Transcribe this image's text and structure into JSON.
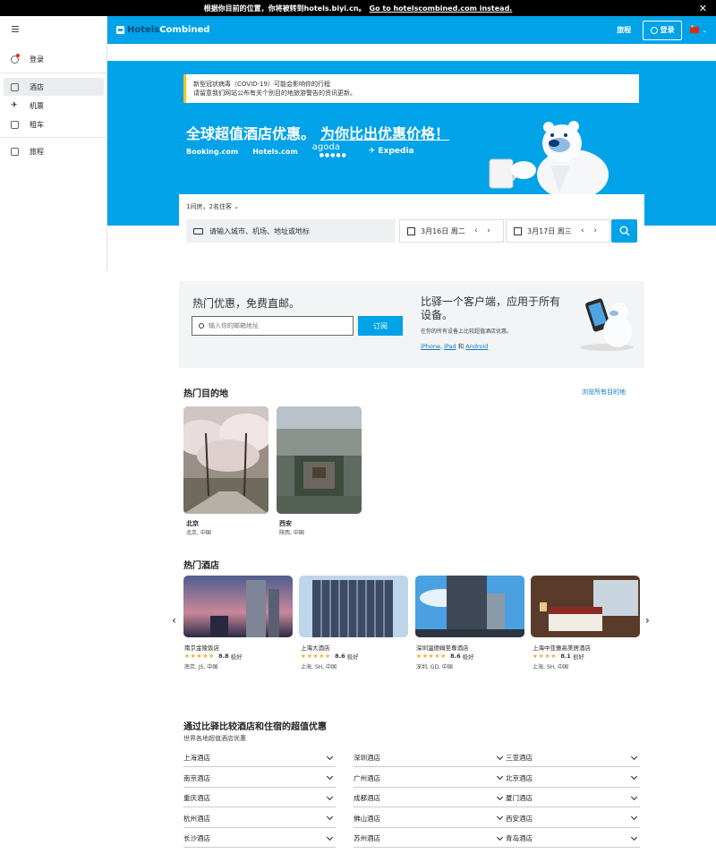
{
  "banner": {
    "text": "根据你目前的位置，你将被转到hotels.biyi.cn。",
    "link": "Go to hotelscombined.com instead."
  },
  "header": {
    "logo_part1": "Hotels",
    "logo_part2": "Combined",
    "trips": "旅程",
    "login": "登录"
  },
  "sidebar": {
    "login": "登录",
    "items": [
      {
        "label": "酒店"
      },
      {
        "label": "机票"
      },
      {
        "label": "租车"
      },
      {
        "label": "旅程"
      }
    ]
  },
  "hero": {
    "covid_line1": "新型冠状病毒（COVID-19）可能会影响你的行程",
    "covid_line2": "请留意我们网站公布有关个别目的地旅游警告的资讯更新。",
    "title": "全球超值酒店优惠。",
    "title_bold": "为你比出优惠价格！",
    "partners": [
      "Booking.com",
      "Hotels.com",
      "agoda",
      "Expedia"
    ]
  },
  "search": {
    "guests": "1间房，2名住客",
    "destination_placeholder": "请输入城市、机场、地址或地标",
    "checkin": "3月16日 周二",
    "checkout": "3月17日 周三"
  },
  "promo": {
    "title": "热门优惠，免费直邮。",
    "email_placeholder": "输入你的邮箱地址",
    "subscribe": "订阅",
    "app_title": "比驿一个客户端，应用于所有设备。",
    "app_sub": "在你的所有设备上比较超值酒店优惠。",
    "app_links": [
      "iPhone",
      "iPad",
      "Android"
    ],
    "app_and": "和"
  },
  "destinations": {
    "title": "热门目的地",
    "see_all": "浏览所有目的地",
    "items": [
      {
        "name": "北京",
        "sub": "北京, 中国"
      },
      {
        "name": "西安",
        "sub": "陕西, 中国"
      }
    ]
  },
  "hotels": {
    "title": "热门酒店",
    "items": [
      {
        "name": "南京金陵饭店",
        "score": "8.8",
        "label": "极好",
        "loc": "南京, JS, 中国"
      },
      {
        "name": "上海大酒店",
        "score": "8.6",
        "label": "极好",
        "loc": "上海, SH, 中国"
      },
      {
        "name": "深圳温德姆至尊酒店",
        "score": "8.6",
        "label": "极好",
        "loc": "深圳, GD, 中国"
      },
      {
        "name": "上海中亚雅高美居酒店",
        "score": "8.1",
        "label": "很好",
        "loc": "上海, SH, 中国"
      }
    ]
  },
  "deals": {
    "title": "通过比驿比较酒店和住宿的超值优惠",
    "sub": "世界各地超值酒店优惠",
    "items": [
      "上海酒店",
      "深圳酒店",
      "三亚酒店",
      "南京酒店",
      "广州酒店",
      "北京酒店",
      "重庆酒店",
      "成都酒店",
      "厦门酒店",
      "杭州酒店",
      "佛山酒店",
      "西安酒店",
      "长沙酒店",
      "苏州酒店",
      "青岛酒店"
    ]
  },
  "colors": {
    "brand": "#00a2e8",
    "star": "#f5a623"
  }
}
